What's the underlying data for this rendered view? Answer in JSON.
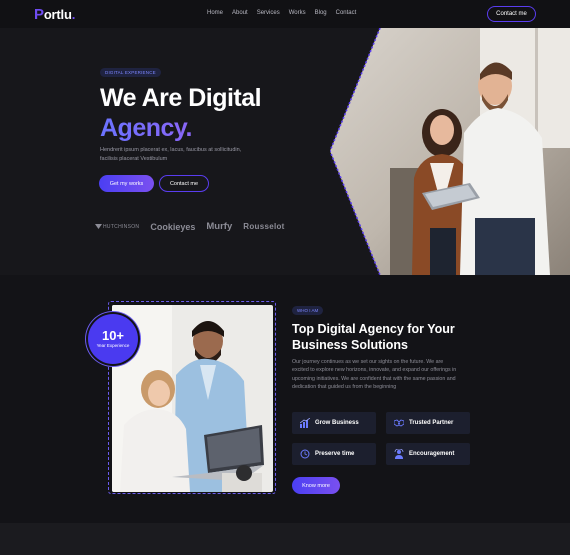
{
  "nav": {
    "logo": "ortlu",
    "logo_initial": "P",
    "logo_dot": ".",
    "links": [
      "Home",
      "About",
      "Services",
      "Works",
      "Blog",
      "Contact"
    ],
    "cta": "Contact me"
  },
  "hero": {
    "badge": "DIGITAL EXPERIENCE",
    "title_line1": "We Are Digital",
    "title_line2": "Agency.",
    "description": "Hendrerit ipsum placerat ex, lacus, faucibus at sollicitudin, facilisis placerat Vestibulum",
    "primary_button": "Get my works",
    "secondary_button": "Contact me",
    "brands": [
      "HUTCHINSON",
      "Cookieyes",
      "Murfy",
      "Rousselot"
    ]
  },
  "about": {
    "experience_number": "10+",
    "experience_label": "Year Experience",
    "tag": "WHO I AM",
    "title": "Top Digital Agency for Your Business Solutions",
    "description": "Our journey continues as we set our sights on the future. We are excited to explore new horizons, innovate, and expand our offerings in upcoming initiatives. We are confident that with the same passion and dedication that guided us from the beginning",
    "features": [
      {
        "label": "Grow Business",
        "icon": "chart-icon"
      },
      {
        "label": "Trusted Partner",
        "icon": "handshake-icon"
      },
      {
        "label": "Preserve time",
        "icon": "clock-icon"
      },
      {
        "label": "Encouragement",
        "icon": "support-icon"
      }
    ],
    "button": "Know more"
  },
  "colors": {
    "accent": "#5a3df0",
    "accent_light": "#7c86ff",
    "background": "#131317"
  }
}
